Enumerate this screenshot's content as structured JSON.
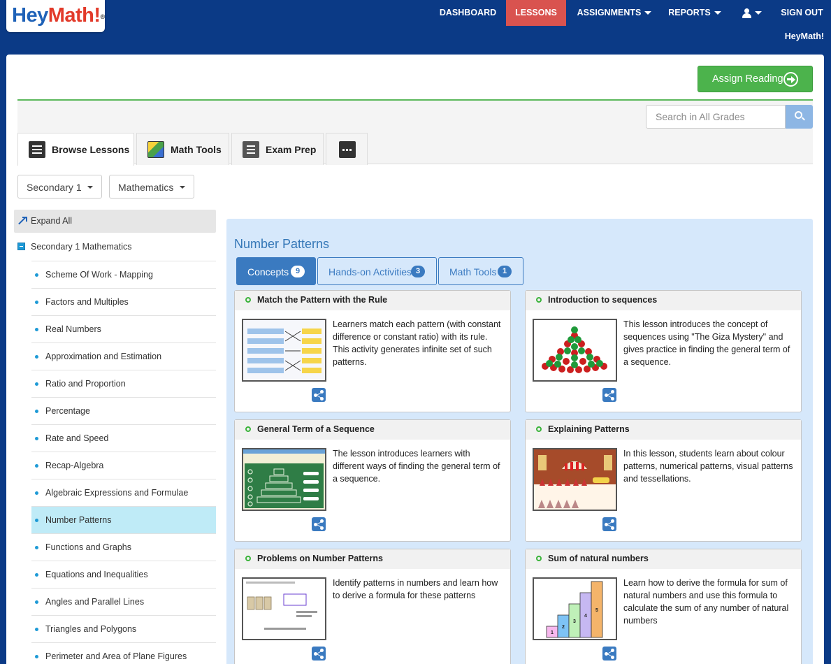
{
  "brand": {
    "logo_hey": "Hey",
    "logo_math": "Math!",
    "logo_reg": "®",
    "org_name": "HeyMath!"
  },
  "nav": {
    "dashboard": "DASHBOARD",
    "lessons": "LESSONS",
    "assignments": "ASSIGNMENTS",
    "reports": "REPORTS",
    "signout": "SIGN OUT",
    "user_icon": "user-icon"
  },
  "toolbar": {
    "assign_label": "Assign Reading",
    "assign_icon": "arrow-circle-right-icon"
  },
  "search": {
    "placeholder": "Search in All Grades",
    "value": ""
  },
  "tabs": [
    {
      "label": "Browse Lessons",
      "icon": "list-icon",
      "active": true
    },
    {
      "label": "Math Tools",
      "icon": "math-tools-icon",
      "active": false
    },
    {
      "label": "Exam Prep",
      "icon": "exam-icon",
      "active": false
    },
    {
      "label": "",
      "icon": "more-icon",
      "active": false
    }
  ],
  "filters": {
    "grade": "Secondary 1",
    "subject": "Mathematics"
  },
  "sidebar": {
    "expand_all": "Expand All",
    "root": "Secondary 1 Mathematics",
    "items": [
      "Scheme Of Work - Mapping",
      "Factors and Multiples",
      "Real Numbers",
      "Approximation and Estimation",
      "Ratio and Proportion",
      "Percentage",
      "Rate and Speed",
      "Recap-Algebra",
      "Algebraic Expressions and Formulae",
      "Number Patterns",
      "Functions and Graphs",
      "Equations and Inequalities",
      "Angles and Parallel Lines",
      "Triangles and Polygons",
      "Perimeter and Area of Plane Figures"
    ],
    "active_item": "Number Patterns"
  },
  "content": {
    "title": "Number Patterns",
    "tabs": [
      {
        "label": "Concepts",
        "count": "9",
        "active": true
      },
      {
        "label": "Hands-on Activities",
        "count": "3",
        "active": false
      },
      {
        "label": "Math Tools",
        "count": "1",
        "active": false
      }
    ],
    "cards": [
      {
        "title": "Match the Pattern with the Rule",
        "desc": "Learners match each pattern (with constant difference or constant ratio) with its rule. This activity generates infinite set of such patterns."
      },
      {
        "title": "Introduction to sequences",
        "desc": "This lesson introduces the concept of sequences using \"The Giza Mystery\" and gives practice in finding the general term of a sequence."
      },
      {
        "title": "General Term of a Sequence",
        "desc": "The lesson introduces learners with different ways of finding the general term of a sequence."
      },
      {
        "title": "Explaining Patterns",
        "desc": "In this lesson, students learn about colour patterns, numerical patterns, visual patterns and tessellations."
      },
      {
        "title": "Problems on Number Patterns",
        "desc": "Identify patterns in numbers and learn how to derive a formula for these patterns"
      },
      {
        "title": "Sum of natural numbers",
        "desc": "Learn how to derive the formula for sum of natural numbers and use this formula to calculate the sum of any number of natural numbers"
      }
    ],
    "thumb_labels": {
      "sum_bars": [
        "1",
        "2",
        "3",
        "4",
        "5"
      ]
    },
    "share_icon": "share-icon"
  },
  "colors": {
    "header_bg": "#0b3a86",
    "active_nav": "#d9534f",
    "assign_green": "#4cb34c",
    "accent_blue": "#3a7ac0",
    "content_bg": "#d6e8fb",
    "active_tree": "#bfebf7"
  }
}
